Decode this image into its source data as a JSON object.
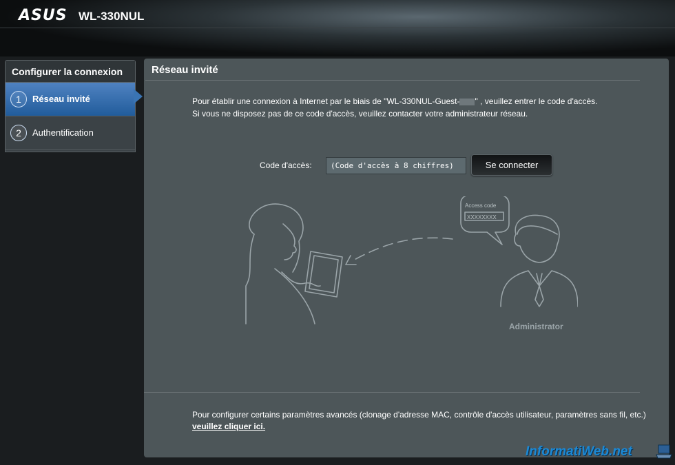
{
  "header": {
    "logo_text": "ASUS",
    "model": "WL-330NUL"
  },
  "sidebar": {
    "title": "Configurer la connexion",
    "steps": [
      {
        "number": "1",
        "label": "Réseau invité",
        "active": true
      },
      {
        "number": "2",
        "label": "Authentification",
        "active": false
      }
    ]
  },
  "panel": {
    "title": "Réseau invité",
    "intro_part1": "Pour établir une connexion à Internet par le biais de \"WL-330NUL-Guest-",
    "intro_part2": "\" , veuillez entrer le code d'accès. Si vous ne disposez pas de ce code d'accès, veuillez contacter votre administrateur réseau.",
    "code_label": "Code d'accès:",
    "code_placeholder": "(Code d'accès à 8 chiffres)",
    "connect_button": "Se connecter",
    "illustration": {
      "bubble_title": "Access code",
      "bubble_value": "XXXXXXXX",
      "admin_label": "Administrator"
    },
    "bottom_text": "Pour configurer certains paramètres avancés (clonage d'adresse MAC, contrôle d'accès utilisateur, paramètres sans fil, etc.) ",
    "bottom_link": "veuillez cliquer ici."
  },
  "watermark": "InformatiWeb.net",
  "colors": {
    "accent": "#2f6fb0",
    "panel_bg": "#4d5659",
    "watermark": "#1b89d6"
  }
}
